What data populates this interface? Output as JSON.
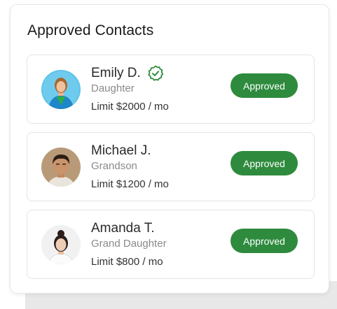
{
  "panel": {
    "title": "Approved Contacts"
  },
  "colors": {
    "approved_badge": "#2e8b3e",
    "verified_icon": "#2e8b3e"
  },
  "contacts": [
    {
      "name": "Emily D.",
      "relation": "Daughter",
      "limit": "Limit $2000 / mo",
      "status": "Approved",
      "verified": true,
      "avatar": "avatar-woman-blue-background"
    },
    {
      "name": "Michael J.",
      "relation": "Grandson",
      "limit": "Limit $1200 / mo",
      "status": "Approved",
      "verified": false,
      "avatar": "avatar-man-dark-hair"
    },
    {
      "name": "Amanda T.",
      "relation": "Grand Daughter",
      "limit": "Limit $800 / mo",
      "status": "Approved",
      "verified": false,
      "avatar": "avatar-woman-hair-bun"
    }
  ]
}
